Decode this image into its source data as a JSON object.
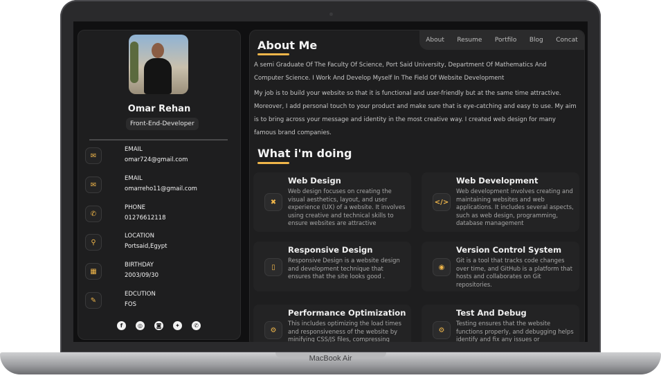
{
  "device_label": "MacBook Air",
  "profile": {
    "name": "Omar Rehan",
    "role": "Front-End-Developer",
    "contacts": [
      {
        "icon": "mail-icon",
        "glyph": "✉",
        "title": "EMAIL",
        "value": "omar724@gmail.com"
      },
      {
        "icon": "mail-icon",
        "glyph": "✉",
        "title": "EMAIL",
        "value": "omarreho11@gmail.com"
      },
      {
        "icon": "phone-icon",
        "glyph": "✆",
        "title": "PHONE",
        "value": "01276612118"
      },
      {
        "icon": "location-pin-icon",
        "glyph": "⚲",
        "title": "LOCATION",
        "value": "Portsaid,Egypt"
      },
      {
        "icon": "calendar-icon",
        "glyph": "▦",
        "title": "BIRTHDAY",
        "value": "2003/09/30"
      },
      {
        "icon": "education-icon",
        "glyph": "✎",
        "title": "EDCUTION",
        "value": "FOS"
      }
    ],
    "socials": [
      {
        "icon": "facebook-icon",
        "glyph": "f"
      },
      {
        "icon": "instagram-icon",
        "glyph": "◎"
      },
      {
        "icon": "discord-icon",
        "glyph": "◙"
      },
      {
        "icon": "twitter-icon",
        "glyph": "✦"
      },
      {
        "icon": "whatsapp-icon",
        "glyph": "✆"
      }
    ]
  },
  "nav": [
    "About",
    "Resume",
    "Portfilo",
    "Blog",
    "Concat"
  ],
  "about": {
    "heading": "About Me",
    "paragraph1": "A semi Graduate Of The Faculty Of Science, Port Said University, Department Of Mathematics And Computer Science. I Work And Develop Myself In The Field Of Website Development",
    "paragraph2": "My job is to build your website so that it is functional and user-friendly but at the same time attractive. Moreover, I add personal touch to your product and make sure that is eye-catching and easy to use. My aim is to bring across your message and identity in the most creative way. I created web design for many famous brand companies."
  },
  "services": {
    "heading": "What i'm doing",
    "items": [
      {
        "icon": "design-icon",
        "glyph": "✖",
        "title": "Web Design",
        "text": "Web design focuses on creating the visual aesthetics, layout, and user experience (UX) of a website. It involves using creative and technical skills to ensure websites are attractive"
      },
      {
        "icon": "code-icon",
        "glyph": "</>",
        "title": "Web Development",
        "text": "Web development involves creating and maintaining websites and web applications. It includes several aspects, such as web design, programming, database management"
      },
      {
        "icon": "mobile-icon",
        "glyph": "▯",
        "title": "Responsive Design",
        "text": "Responsive Design is a website design and development technique that ensures that the site looks good ."
      },
      {
        "icon": "github-icon",
        "glyph": "◉",
        "title": "Version Control System",
        "text": "Git is a tool that tracks code changes over time, and GitHub is a platform that hosts and collaborates on Git repositories."
      },
      {
        "icon": "gears-icon",
        "glyph": "⚙",
        "title": "Performance Optimization",
        "text": "This includes optimizing the load times and responsiveness of the website by minifying CSS/JS files, compressing"
      },
      {
        "icon": "gears-icon",
        "glyph": "⚙",
        "title": "Test And Debug",
        "text": "Testing ensures that the website functions properly, and debugging helps identify and fix any issues or"
      }
    ]
  },
  "colors": {
    "accent": "#f0b64a",
    "background": "#101011",
    "panel": "#1e1e1f"
  }
}
